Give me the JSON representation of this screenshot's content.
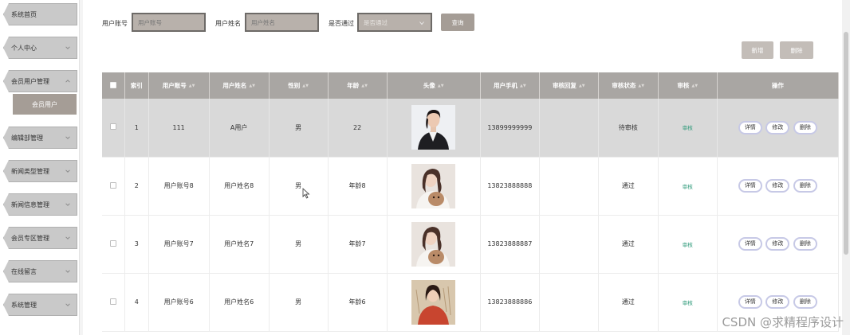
{
  "sidebar": {
    "items": [
      {
        "label": "系统首页"
      },
      {
        "label": "个人中心"
      },
      {
        "label": "会员用户管理",
        "expanded": true,
        "children": [
          {
            "label": "会员用户"
          }
        ]
      },
      {
        "label": "编辑部管理"
      },
      {
        "label": "新闻类型管理"
      },
      {
        "label": "新闻信息管理"
      },
      {
        "label": "会员专区管理"
      },
      {
        "label": "在线留言"
      },
      {
        "label": "系统管理"
      }
    ]
  },
  "search": {
    "account_label": "用户账号",
    "account_placeholder": "用户账号",
    "name_label": "用户姓名",
    "name_placeholder": "用户姓名",
    "passed_label": "是否通过",
    "passed_placeholder": "是否通过",
    "query_button": "查询"
  },
  "toolbar": {
    "add_button": "新增",
    "delete_button": "删除"
  },
  "table": {
    "columns": [
      "索引",
      "用户账号",
      "用户姓名",
      "性别",
      "年龄",
      "头像",
      "用户手机",
      "审核回复",
      "审核状态",
      "审核",
      "操作"
    ],
    "rows": [
      {
        "index": "1",
        "account": "111",
        "name": "A用户",
        "gender": "男",
        "age": "22",
        "phone": "13899999999",
        "reply": "",
        "status": "待审核",
        "audit": "审核"
      },
      {
        "index": "2",
        "account": "用户账号8",
        "name": "用户姓名8",
        "gender": "男",
        "age": "年龄8",
        "phone": "13823888888",
        "reply": "",
        "status": "通过",
        "audit": "审核"
      },
      {
        "index": "3",
        "account": "用户账号7",
        "name": "用户姓名7",
        "gender": "男",
        "age": "年龄7",
        "phone": "13823888887",
        "reply": "",
        "status": "通过",
        "audit": "审核"
      },
      {
        "index": "4",
        "account": "用户账号6",
        "name": "用户姓名6",
        "gender": "男",
        "age": "年龄6",
        "phone": "13823888886",
        "reply": "",
        "status": "通过",
        "audit": "审核"
      }
    ],
    "actions": {
      "detail": "详情",
      "edit": "修改",
      "delete": "删除"
    }
  },
  "watermark": "CSDN @求精程序设计",
  "colors": {
    "accent": "#a59d96",
    "header_bg": "#a9a6a3",
    "audit_link": "#2e9a7a",
    "op_border": "#c7c9e6"
  }
}
